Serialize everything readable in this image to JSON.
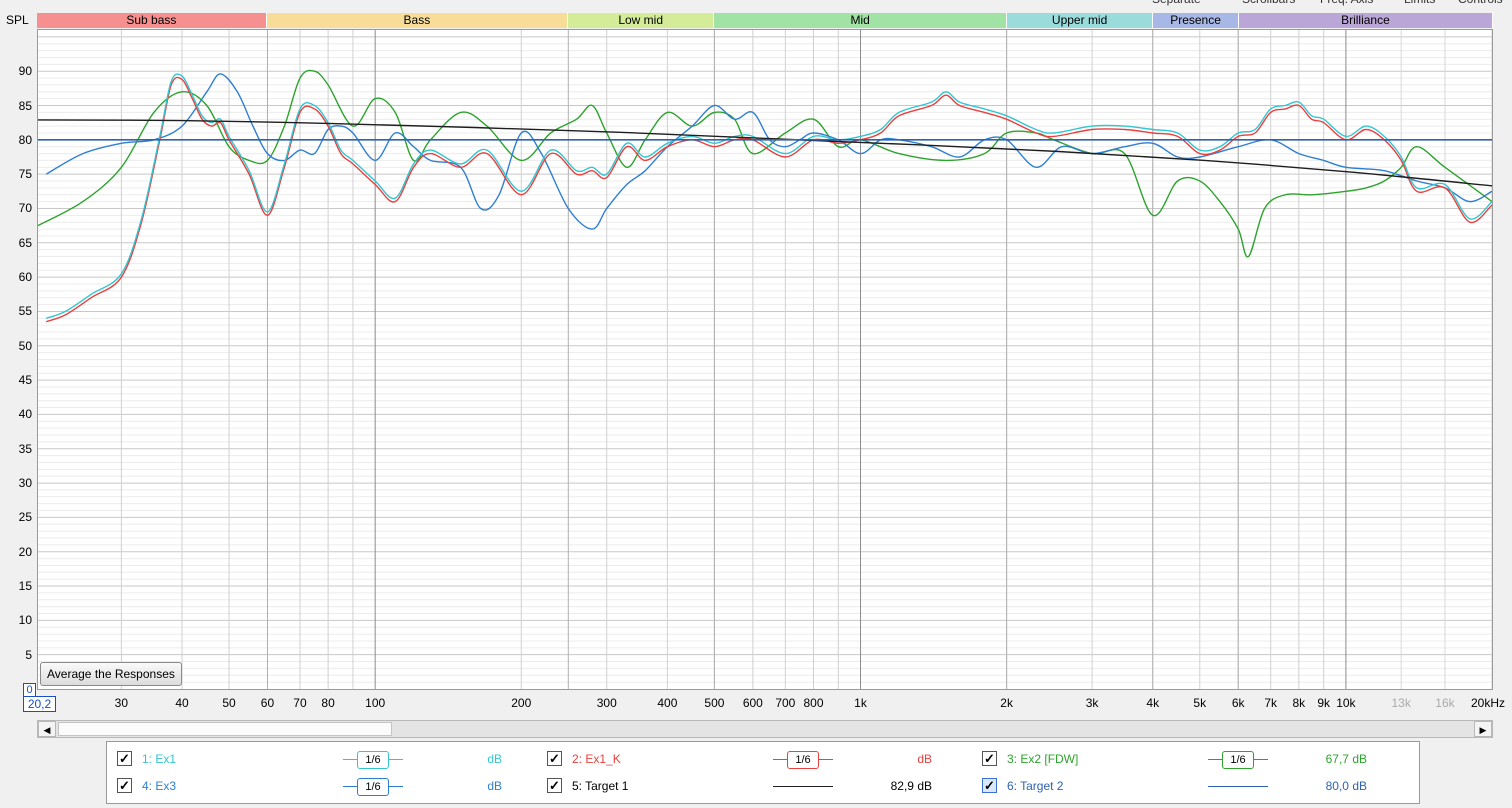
{
  "top_menu": [
    "Separate",
    "Scrollbars",
    "Freq. Axis",
    "Limits",
    "Controls"
  ],
  "colors": {
    "ex1": "#33c6d1",
    "ex1_k": "#e8413f",
    "ex2": "#2da32d",
    "ex3": "#2f7fd1",
    "target1": "#1e1e1e",
    "target2": "#2f62b0"
  },
  "chart_data": {
    "type": "line",
    "ylabel": "SPL",
    "xlabel": "",
    "x_scale": "log",
    "xlim": [
      20.2,
      20000
    ],
    "ylim": [
      0,
      96
    ],
    "y_ticks": [
      5,
      10,
      15,
      20,
      25,
      30,
      35,
      40,
      45,
      50,
      55,
      60,
      65,
      70,
      75,
      80,
      85,
      90
    ],
    "x_ticks": [
      {
        "v": 30,
        "t": "30"
      },
      {
        "v": 40,
        "t": "40"
      },
      {
        "v": 50,
        "t": "50"
      },
      {
        "v": 60,
        "t": "60"
      },
      {
        "v": 70,
        "t": "70"
      },
      {
        "v": 80,
        "t": "80"
      },
      {
        "v": 100,
        "t": "100"
      },
      {
        "v": 200,
        "t": "200"
      },
      {
        "v": 300,
        "t": "300"
      },
      {
        "v": 400,
        "t": "400"
      },
      {
        "v": 500,
        "t": "500"
      },
      {
        "v": 600,
        "t": "600"
      },
      {
        "v": 700,
        "t": "700"
      },
      {
        "v": 800,
        "t": "800"
      },
      {
        "v": 1000,
        "t": "1k"
      },
      {
        "v": 2000,
        "t": "2k"
      },
      {
        "v": 3000,
        "t": "3k"
      },
      {
        "v": 4000,
        "t": "4k"
      },
      {
        "v": 5000,
        "t": "5k"
      },
      {
        "v": 6000,
        "t": "6k"
      },
      {
        "v": 7000,
        "t": "7k"
      },
      {
        "v": 8000,
        "t": "8k"
      },
      {
        "v": 9000,
        "t": "9k"
      },
      {
        "v": 10000,
        "t": "10k"
      },
      {
        "v": 13000,
        "t": "13k",
        "minor": true
      },
      {
        "v": 16000,
        "t": "16k",
        "minor": true
      },
      {
        "v": 20000,
        "t": "20kHz"
      }
    ],
    "bands": [
      {
        "name": "Sub bass",
        "from": 20.2,
        "to": 60,
        "color": "#f69090"
      },
      {
        "name": "Bass",
        "from": 60,
        "to": 250,
        "color": "#f7dd98"
      },
      {
        "name": "Low mid",
        "from": 250,
        "to": 500,
        "color": "#d4ec98"
      },
      {
        "name": "Mid",
        "from": 500,
        "to": 2000,
        "color": "#a0e3a4"
      },
      {
        "name": "Upper mid",
        "from": 2000,
        "to": 4000,
        "color": "#9adcdc"
      },
      {
        "name": "Presence",
        "from": 4000,
        "to": 6000,
        "color": "#a8b8e6"
      },
      {
        "name": "Brilliance",
        "from": 6000,
        "to": 20000,
        "color": "#bba6d8"
      }
    ],
    "series": [
      {
        "key": "ex2",
        "name": "3: Ex2 [FDW]",
        "x": [
          20.2,
          25,
          30,
          35,
          40,
          45,
          50,
          55,
          60,
          65,
          70,
          75,
          80,
          90,
          100,
          110,
          120,
          130,
          150,
          170,
          200,
          230,
          260,
          280,
          300,
          330,
          360,
          400,
          450,
          500,
          550,
          600,
          700,
          800,
          900,
          1000,
          1200,
          1500,
          1800,
          2000,
          2300,
          2500,
          3000,
          3500,
          4000,
          4500,
          5000,
          5500,
          6000,
          6300,
          6800,
          7500,
          8500,
          10000,
          11000,
          12000,
          13000,
          14000,
          16000,
          20000
        ],
        "y": [
          67.5,
          71,
          76,
          84,
          87,
          85,
          79,
          77,
          77,
          82,
          89,
          90,
          88,
          82,
          86,
          84,
          77,
          80,
          84,
          82,
          77,
          81,
          83,
          85,
          81,
          76,
          80,
          84,
          82,
          84,
          83,
          78,
          81,
          83,
          79,
          80,
          78,
          77,
          78,
          81,
          81,
          80,
          78,
          78,
          69,
          74,
          74,
          71,
          67,
          63,
          70,
          72,
          72,
          72.5,
          73,
          74,
          76,
          79,
          76,
          71
        ]
      },
      {
        "key": "ex3",
        "name": "4: Ex3",
        "x": [
          21,
          25,
          30,
          35,
          40,
          45,
          48,
          52,
          56,
          60,
          65,
          70,
          75,
          80,
          85,
          90,
          100,
          110,
          120,
          130,
          150,
          165,
          180,
          200,
          220,
          250,
          280,
          300,
          330,
          360,
          400,
          450,
          500,
          550,
          600,
          650,
          700,
          750,
          800,
          900,
          1000,
          1100,
          1200,
          1400,
          1600,
          1800,
          2000,
          2300,
          2600,
          3000,
          3500,
          4000,
          4500,
          5000,
          6000,
          7000,
          8000,
          9000,
          10000,
          12000,
          14000,
          16000,
          18000,
          20000
        ],
        "y": [
          75,
          78,
          79.5,
          80,
          82,
          87,
          89.6,
          87,
          82,
          78,
          77,
          78.5,
          78,
          81.5,
          82,
          81,
          77,
          81,
          79,
          77,
          76,
          70,
          72,
          81,
          78,
          70,
          67,
          70,
          73.5,
          75.5,
          79,
          82,
          85,
          83,
          84,
          80,
          79,
          80,
          81,
          80,
          78,
          80,
          80,
          79,
          77.5,
          80,
          80,
          76,
          79,
          78,
          79,
          79.5,
          77.5,
          77.5,
          79,
          80,
          78,
          77,
          76,
          75.5,
          74,
          73,
          71,
          72.5
        ]
      },
      {
        "key": "ex1_k",
        "name": "2: Ex1_K",
        "x": [
          21,
          23,
          26,
          30,
          33,
          36,
          38,
          40,
          42,
          44,
          46,
          48,
          50,
          55,
          60,
          65,
          70,
          75,
          80,
          85,
          90,
          100,
          110,
          120,
          130,
          150,
          170,
          200,
          230,
          260,
          280,
          300,
          330,
          360,
          400,
          450,
          500,
          550,
          600,
          700,
          800,
          900,
          1000,
          1100,
          1200,
          1400,
          1500,
          1600,
          1800,
          2000,
          2300,
          2500,
          3000,
          3500,
          4000,
          4500,
          5000,
          5500,
          6000,
          6500,
          7000,
          7500,
          8000,
          8500,
          9000,
          10000,
          11000,
          12000,
          13000,
          14000,
          16000,
          18000,
          20000
        ],
        "y": [
          53.5,
          54.5,
          57,
          60,
          68,
          80,
          88,
          88.8,
          86,
          83,
          82,
          82.5,
          80,
          75,
          69,
          76,
          84,
          84.5,
          82,
          78,
          76.5,
          73.5,
          71,
          76,
          78,
          76,
          78,
          72,
          78,
          75,
          75.5,
          74.5,
          79,
          77,
          79,
          80,
          79,
          80,
          80,
          77.5,
          80,
          79.5,
          80,
          81,
          83.5,
          85,
          86.5,
          85,
          84,
          83,
          81,
          80.5,
          81.5,
          81.5,
          81,
          80.5,
          78,
          78.5,
          80.5,
          81,
          84,
          84.5,
          85,
          83,
          82.5,
          80,
          81.5,
          80,
          77,
          72.5,
          73,
          68,
          70.5
        ]
      },
      {
        "key": "ex1",
        "name": "1: Ex1",
        "x": [
          21,
          23,
          26,
          30,
          33,
          36,
          38,
          40,
          42,
          44,
          46,
          48,
          50,
          55,
          60,
          65,
          70,
          75,
          80,
          85,
          90,
          100,
          110,
          120,
          130,
          150,
          170,
          200,
          230,
          260,
          280,
          300,
          330,
          360,
          400,
          450,
          500,
          550,
          600,
          700,
          800,
          900,
          1000,
          1100,
          1200,
          1400,
          1500,
          1600,
          1800,
          2000,
          2300,
          2500,
          3000,
          3500,
          4000,
          4500,
          5000,
          5500,
          6000,
          6500,
          7000,
          7500,
          8000,
          8500,
          9000,
          10000,
          11000,
          12000,
          13000,
          14000,
          16000,
          18000,
          20000
        ],
        "y": [
          54,
          55,
          57.5,
          60.5,
          68.5,
          80.5,
          88.5,
          89.3,
          86.5,
          83.5,
          82.5,
          83,
          80.5,
          75.5,
          69.5,
          76.5,
          84.5,
          85,
          82.5,
          78.5,
          77,
          74,
          71.5,
          76.5,
          78.5,
          76.5,
          78.5,
          72.5,
          78.5,
          75.5,
          76,
          75,
          79.5,
          77.5,
          79.5,
          80.5,
          79.5,
          80.5,
          80.5,
          78,
          80.5,
          80,
          80.5,
          81.5,
          84,
          85.5,
          87,
          85.5,
          84.5,
          83.5,
          81.5,
          81,
          82,
          82,
          81.5,
          81,
          78.5,
          79,
          81,
          81.5,
          84.5,
          85,
          85.5,
          83.5,
          83,
          80.5,
          82,
          80.5,
          77.5,
          73,
          73.5,
          68.5,
          71
        ]
      },
      {
        "key": "target1",
        "name": "5: Target 1",
        "x": [
          20.2,
          40,
          80,
          160,
          320,
          640,
          1280,
          2560,
          5120,
          10240,
          20000
        ],
        "y": [
          82.9,
          82.8,
          82.4,
          81.8,
          81.1,
          80.2,
          79.3,
          78.3,
          77.0,
          75.3,
          73.3
        ]
      },
      {
        "key": "target2",
        "name": "6: Target 2",
        "x": [
          20.2,
          20000
        ],
        "y": [
          80,
          80
        ]
      }
    ]
  },
  "controls": {
    "avg_button": "Average the Responses",
    "corner_y": "0",
    "corner_x": "20,2",
    "scroll_left": "◀",
    "scroll_right": "▶"
  },
  "legend": [
    {
      "key": "ex1",
      "checked": true,
      "name": "1: Ex1",
      "smoothing": "1/6",
      "value": "dB",
      "col": 0,
      "row": 0
    },
    {
      "key": "ex1_k",
      "checked": true,
      "name": "2: Ex1_K",
      "smoothing": "1/6",
      "value": "dB",
      "col": 1,
      "row": 0
    },
    {
      "key": "ex2",
      "checked": true,
      "name": "3: Ex2 [FDW]",
      "smoothing": "1/6",
      "value": "67,7 dB",
      "col": 2,
      "row": 0
    },
    {
      "key": "ex3",
      "checked": true,
      "name": "4: Ex3",
      "smoothing": "1/6",
      "value": "dB",
      "col": 0,
      "row": 1
    },
    {
      "key": "target1",
      "checked": true,
      "name": "5: Target 1",
      "smoothing": "",
      "value": "82,9 dB",
      "col": 1,
      "row": 1
    },
    {
      "key": "target2",
      "checked": true,
      "selected": true,
      "name": "6: Target 2",
      "smoothing": "",
      "value": "80,0 dB",
      "col": 2,
      "row": 1
    }
  ]
}
